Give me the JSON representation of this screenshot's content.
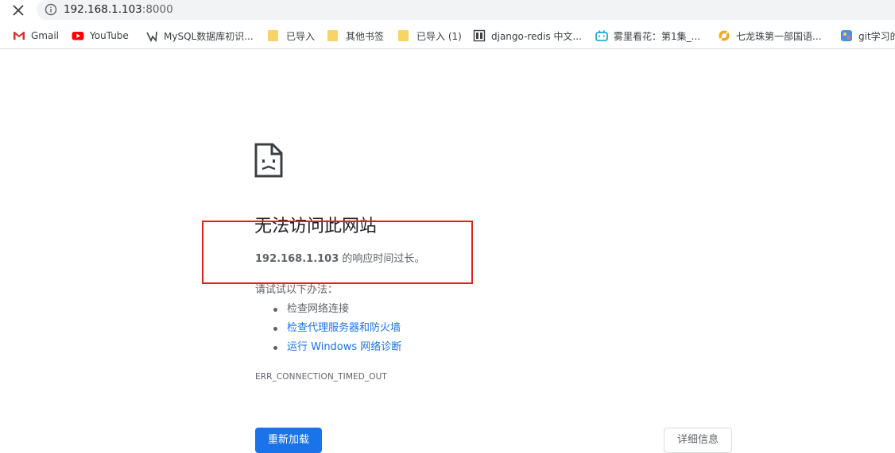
{
  "toolbar": {
    "address": {
      "host": "192.168.1.103",
      "port": ":8000"
    }
  },
  "bookmarks": [
    {
      "label": "Gmail",
      "icon": "gmail-icon"
    },
    {
      "label": "YouTube",
      "icon": "youtube-icon"
    },
    {
      "label": "MySQL数据库初识...",
      "icon": "mysql-icon"
    },
    {
      "label": "已导入",
      "icon": "folder-icon"
    },
    {
      "label": "其他书签",
      "icon": "folder-icon"
    },
    {
      "label": "已导入 (1)",
      "icon": "folder-icon"
    },
    {
      "label": "django-redis 中文...",
      "icon": "book-icon"
    },
    {
      "label": "雾里看花：第1集_...",
      "icon": "bilibili-icon"
    },
    {
      "label": "七龙珠第一部国语...",
      "icon": "site-icon"
    },
    {
      "label": "git学习的",
      "icon": "app-icon"
    }
  ],
  "error": {
    "headline": "无法访问此网站",
    "host": "192.168.1.103",
    "detail_suffix": " 的响应时间过长。",
    "try_label": "请试试以下办法：",
    "suggestions": [
      {
        "label": "检查网络连接"
      },
      {
        "label": "检查代理服务器和防火墙"
      },
      {
        "label": "运行 Windows 网络诊断"
      }
    ],
    "code": "ERR_CONNECTION_TIMED_OUT",
    "reload_label": "重新加载",
    "details_label": "详细信息"
  },
  "colors": {
    "accent": "#1a73e8",
    "highlight": "#e0201f",
    "text_secondary": "#5f6368"
  }
}
